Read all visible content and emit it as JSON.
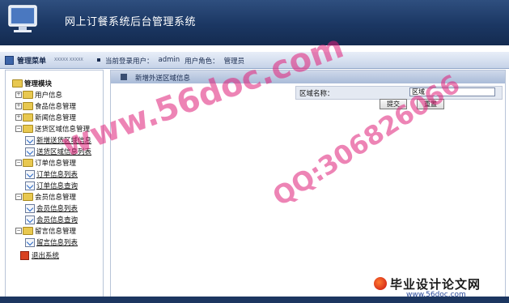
{
  "app": {
    "title": "网上订餐系统后台管理系统"
  },
  "toolbar": {
    "menu_title": "管理菜单",
    "menu_sub": "XXXXX XXXXX",
    "current_user_label": "当前登录用户：",
    "current_user": "admin",
    "role_label": "用户角色：",
    "role": "管理员"
  },
  "sidebar": {
    "root": "管理模块",
    "groups": [
      {
        "label": "用户信息",
        "items": []
      },
      {
        "label": "食品信息管理",
        "items": []
      },
      {
        "label": "新闻信息管理",
        "items": []
      },
      {
        "label": "送货区域信息管理",
        "items": [
          "新增送货区域信息",
          "送货区域信息列表"
        ]
      },
      {
        "label": "订单信息管理",
        "items": [
          "订单信息列表",
          "订单信息查询"
        ]
      },
      {
        "label": "会员信息管理",
        "items": [
          "会员信息列表",
          "会员信息查询"
        ]
      },
      {
        "label": "留言信息管理",
        "items": [
          "留言信息列表"
        ]
      }
    ],
    "exit": "退出系统"
  },
  "main": {
    "title": "新增外送区域信息",
    "form": {
      "label": "区域名称：",
      "value": "区域"
    },
    "submit_label": "提交",
    "reset_label": "重置"
  },
  "watermarks": {
    "site": "www.56doc.com",
    "qq": "QQ:306826066",
    "brand": "毕业设计论文网",
    "brand_url": "www.56doc.com"
  },
  "colors": {
    "header": "#1b3763",
    "accent": "#3c64a8",
    "watermark": "#e0207a"
  }
}
